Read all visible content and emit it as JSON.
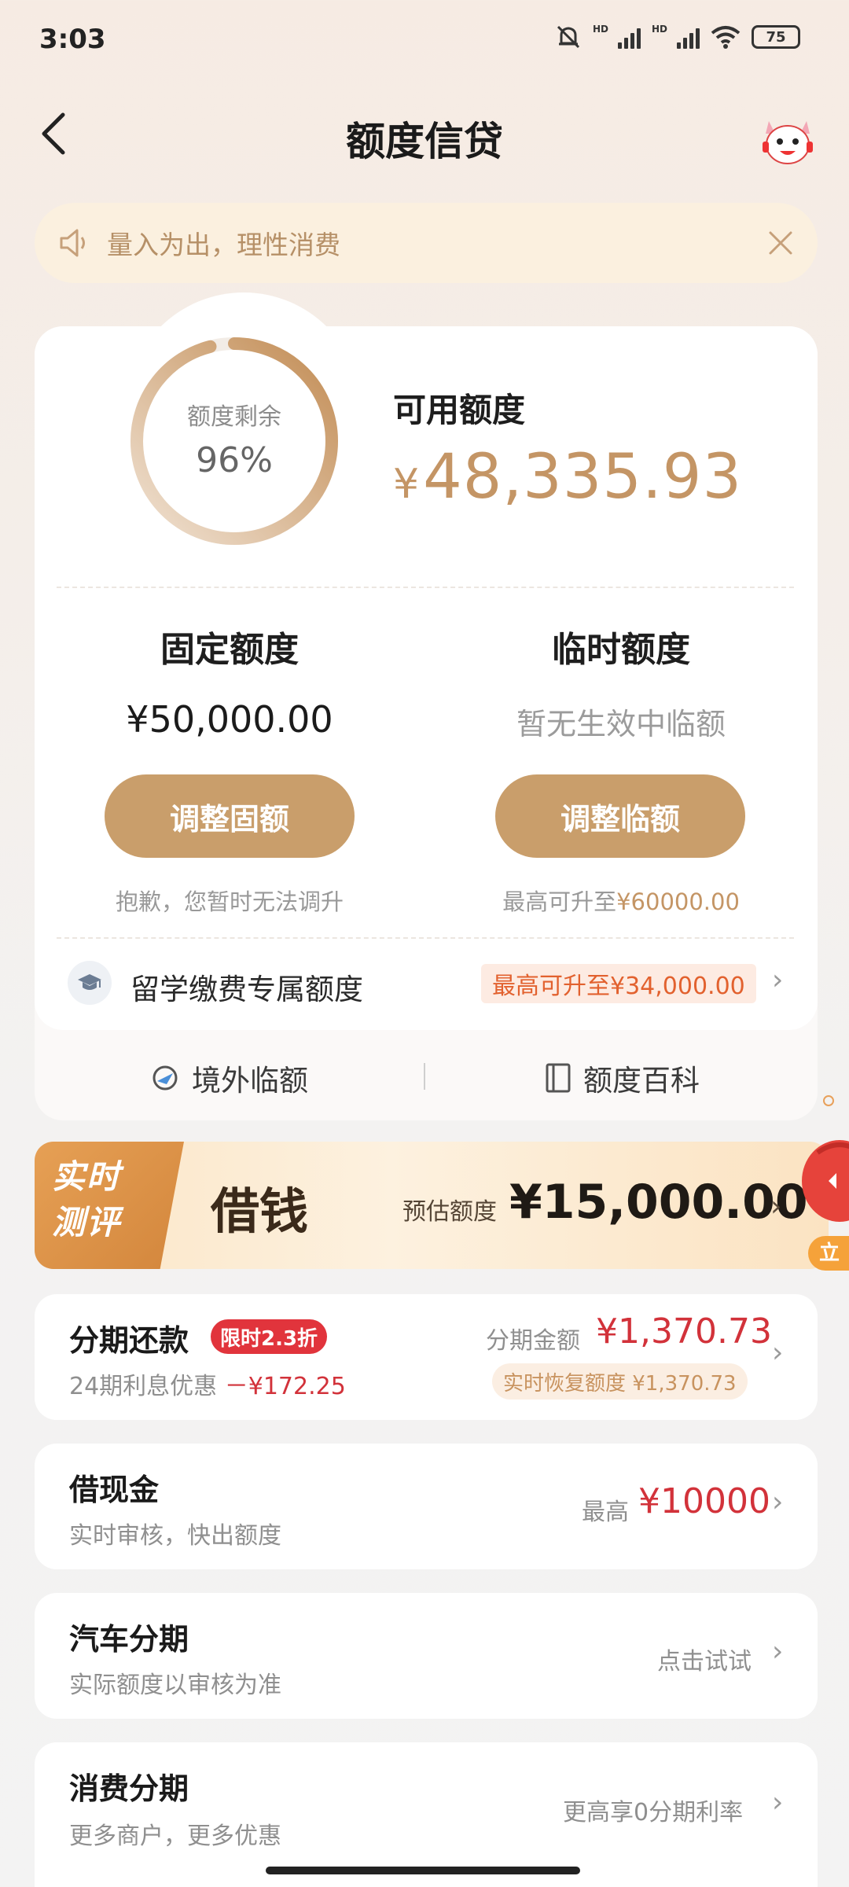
{
  "status": {
    "time": "3:03",
    "battery": "75",
    "hd": "HD"
  },
  "header": {
    "title": "额度信贷"
  },
  "notice": {
    "text": "量入为出，理性消费"
  },
  "credit": {
    "ring_label": "额度剩余",
    "ring_value": "96%",
    "ring_fraction": 0.96,
    "available_label": "可用额度",
    "available_currency": "¥",
    "available_value": "48,335.93"
  },
  "fixed": {
    "title": "固定额度",
    "amount": "¥50,000.00",
    "button": "调整固额",
    "sub": "抱歉，您暂时无法调升"
  },
  "temporary": {
    "title": "临时额度",
    "note": "暂无生效中临额",
    "button": "调整临额",
    "sub_prefix": "最高可升至",
    "sub_amount": "¥60000.00"
  },
  "study": {
    "label": "留学缴费专属额度",
    "tag": "最高可升至¥34,000.00"
  },
  "bottom_links": {
    "left": "境外临额",
    "right": "额度百科"
  },
  "banner": {
    "badge_line1": "实时",
    "badge_line2": "测评",
    "word": "借钱",
    "est_label": "预估额度",
    "est_amount": "¥15,000.00",
    "float_text": "立"
  },
  "cards": {
    "installment": {
      "title": "分期还款",
      "tag": "限时2.3折",
      "sub_prefix": "24期利息优惠",
      "sub_discount": "－¥172.25",
      "amount_label": "分期金额",
      "amount": "¥1,370.73",
      "recover": "实时恢复额度 ¥1,370.73"
    },
    "cash": {
      "title": "借现金",
      "sub": "实时审核，快出额度",
      "right_label": "最高",
      "right_amount": "¥10000"
    },
    "car": {
      "title": "汽车分期",
      "sub": "实际额度以审核为准",
      "right": "点击试试"
    },
    "consume": {
      "title": "消费分期",
      "sub": "更多商户，更多优惠",
      "right": "更高享0分期利率"
    }
  },
  "colors": {
    "accent": "#c99e6b",
    "red": "#d2323a",
    "gold_text": "#c49565"
  }
}
